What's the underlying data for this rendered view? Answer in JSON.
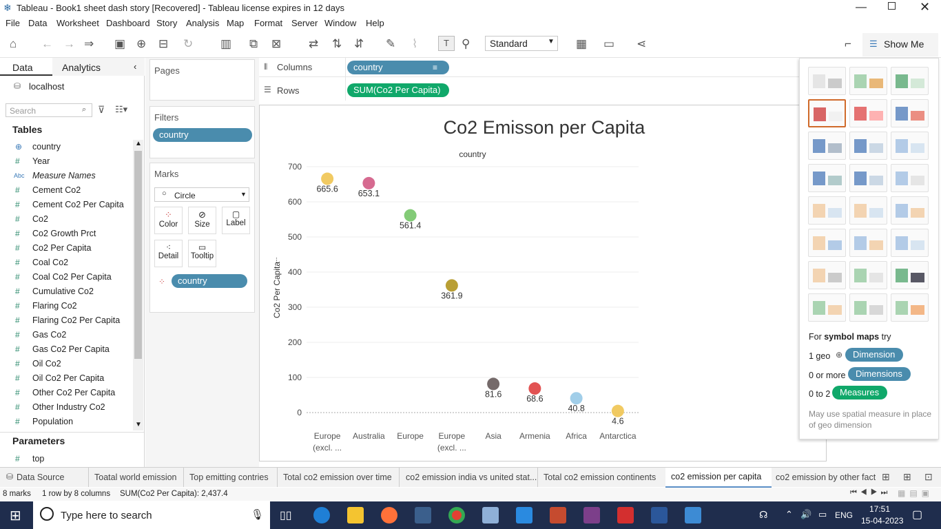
{
  "window": {
    "title": "Tableau - Book1 sheet dash story [Recovered] - Tableau license expires in 12 days"
  },
  "menu": [
    "File",
    "Data",
    "Worksheet",
    "Dashboard",
    "Story",
    "Analysis",
    "Map",
    "Format",
    "Server",
    "Window",
    "Help"
  ],
  "toolbar": {
    "fit_select": "Standard",
    "show_me_label": "Show Me"
  },
  "left_pane": {
    "tab_data": "Data",
    "tab_analytics": "Analytics",
    "connection": "localhost",
    "search_placeholder": "Search",
    "tables_heading": "Tables",
    "fields": [
      {
        "icon": "globe",
        "name": "country"
      },
      {
        "icon": "#",
        "name": "Year"
      },
      {
        "icon": "Abc",
        "name": "Measure Names"
      },
      {
        "icon": "#",
        "name": "Cement Co2"
      },
      {
        "icon": "#",
        "name": "Cement Co2 Per Capita"
      },
      {
        "icon": "#",
        "name": "Co2"
      },
      {
        "icon": "#",
        "name": "Co2 Growth Prct"
      },
      {
        "icon": "#",
        "name": "Co2 Per Capita"
      },
      {
        "icon": "#",
        "name": "Coal Co2"
      },
      {
        "icon": "#",
        "name": "Coal Co2 Per Capita"
      },
      {
        "icon": "#",
        "name": "Cumulative Co2"
      },
      {
        "icon": "#",
        "name": "Flaring Co2"
      },
      {
        "icon": "#",
        "name": "Flaring Co2 Per Capita"
      },
      {
        "icon": "#",
        "name": "Gas Co2"
      },
      {
        "icon": "#",
        "name": "Gas Co2 Per Capita"
      },
      {
        "icon": "#",
        "name": "Oil Co2"
      },
      {
        "icon": "#",
        "name": "Oil Co2 Per Capita"
      },
      {
        "icon": "#",
        "name": "Other Co2 Per Capita"
      },
      {
        "icon": "#",
        "name": "Other Industry Co2"
      },
      {
        "icon": "#",
        "name": "Population"
      }
    ],
    "parameters_heading": "Parameters",
    "parameters": [
      {
        "icon": "#",
        "name": "top"
      }
    ]
  },
  "cards": {
    "pages_title": "Pages",
    "filters_title": "Filters",
    "filter_pill": "country",
    "marks_title": "Marks",
    "mark_type": "Circle",
    "mark_buttons": [
      "Color",
      "Size",
      "Label",
      "Detail",
      "Tooltip"
    ],
    "marks_pill": "country"
  },
  "shelves": {
    "columns_label": "Columns",
    "columns_pill": "country",
    "rows_label": "Rows",
    "rows_pill": "SUM(Co2 Per Capita)"
  },
  "chart_data": {
    "type": "scatter",
    "title": "Co2 Emisson per Capita",
    "header": "country",
    "ylabel": "Co2 Per Capita",
    "ylim": [
      0,
      700
    ],
    "yticks": [
      0,
      100,
      200,
      300,
      400,
      500,
      600,
      700
    ],
    "categories": [
      "Europe (excl. ...",
      "Australia",
      "Europe",
      "Europe (excl. ...",
      "Asia",
      "Armenia",
      "Africa",
      "Antarctica"
    ],
    "category_lines": [
      [
        "Europe",
        "(excl. ..."
      ],
      [
        "Australia"
      ],
      [
        "Europe"
      ],
      [
        "Europe",
        "(excl. ..."
      ],
      [
        "Asia"
      ],
      [
        "Armenia"
      ],
      [
        "Africa"
      ],
      [
        "Antarctica"
      ]
    ],
    "values": [
      665.6,
      653.1,
      561.4,
      361.9,
      81.6,
      68.6,
      40.8,
      4.6
    ],
    "labels": [
      "665.6",
      "653.1",
      "561.4",
      "361.9",
      "81.6",
      "68.6",
      "40.8",
      "4.6"
    ],
    "colors": [
      "#f0c75a",
      "#d4628a",
      "#7cc870",
      "#b59a2a",
      "#6e6262",
      "#e04a4a",
      "#9ccbe8",
      "#f0c75a"
    ]
  },
  "show_me": {
    "hint_prefix": "For ",
    "hint_bold": "symbol maps",
    "hint_suffix": " try",
    "req1_label": "1 geo",
    "req1_pill": "Dimension",
    "req2_label": "0 or more",
    "req2_pill": "Dimensions",
    "req3_label": "0 to 2",
    "req3_pill": "Measures",
    "note": "May use spatial measure in place of geo dimension"
  },
  "sheet_tabs": [
    "Data Source",
    "Toatal world emission",
    "Top emitting contries",
    "Total co2 emission over time",
    "co2 emission india vs united stat...",
    "Total co2 emission continents",
    "co2 emission per capita",
    "co2 emission by other fact"
  ],
  "active_tab": "co2 emission per capita",
  "status": {
    "marks": "8 marks",
    "rows_cols": "1 row by 8 columns",
    "sum": "SUM(Co2 Per Capita): 2,437.4"
  },
  "taskbar": {
    "search_placeholder": "Type here to search",
    "lang": "ENG",
    "time": "17:51",
    "date": "15-04-2023"
  }
}
